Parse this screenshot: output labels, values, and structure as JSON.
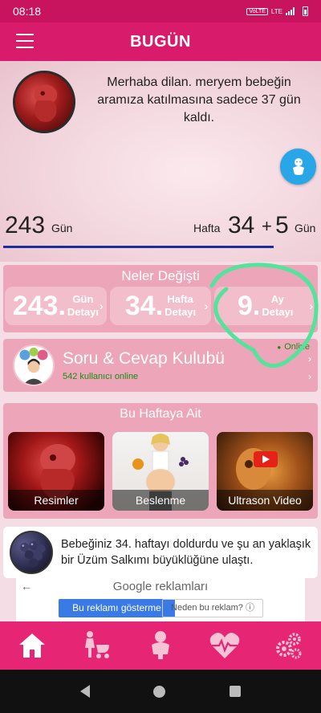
{
  "status_bar": {
    "time": "08:18",
    "network_badge": "VoLTE",
    "network_type": "LTE"
  },
  "app_bar": {
    "title": "BUGÜN",
    "menu_icon": "hamburger-menu-icon"
  },
  "greeting": {
    "text": "Merhaba dilan. meryem bebeğin aramıza katılmasına sadece 37 gün kaldı."
  },
  "counters": {
    "days_value": "243",
    "days_label": "Gün",
    "week_label": "Hafta",
    "week_value": "34",
    "plus": "+",
    "day_value": "5",
    "day_label": "Gün",
    "progress_fraction": 0.86,
    "progress_color": "#1c2d9e"
  },
  "neler_degisti": {
    "title": "Neler Değişti",
    "items": [
      {
        "number": "243.",
        "line1": "Gün",
        "line2": "Detayı"
      },
      {
        "number": "34.",
        "line1": "Hafta",
        "line2": "Detayı"
      },
      {
        "number": "9.",
        "line1": "Ay",
        "line2": "Detayı"
      }
    ]
  },
  "club": {
    "title": "Soru & Cevap Kulubü",
    "subtitle": "542 kullanıcı online",
    "status": "Online",
    "status_color": "#1a8c14"
  },
  "this_week": {
    "title": "Bu Haftaya Ait",
    "items": [
      {
        "label": "Resimler"
      },
      {
        "label": "Beslenme"
      },
      {
        "label": "Ultrason Video"
      }
    ]
  },
  "info_card": {
    "text": "Bebeğiniz 34. haftayı doldurdu ve şu an yaklaşık bir Üzüm Salkımı büyüklüğüne ulaştı."
  },
  "ad": {
    "google_word": "Google",
    "reklam_word": "reklamları",
    "stop_button": "Bu reklamı gösterme",
    "why_button": "Neden bu reklam? ⓘ"
  },
  "bottom_nav": [
    {
      "icon": "home-icon"
    },
    {
      "icon": "mother-stroller-icon"
    },
    {
      "icon": "baby-icon"
    },
    {
      "icon": "heart-pulse-icon"
    },
    {
      "icon": "gears-icon"
    }
  ],
  "colors": {
    "brand": "#d81b6a",
    "nav": "#e62575",
    "fab": "#29a6e8"
  }
}
